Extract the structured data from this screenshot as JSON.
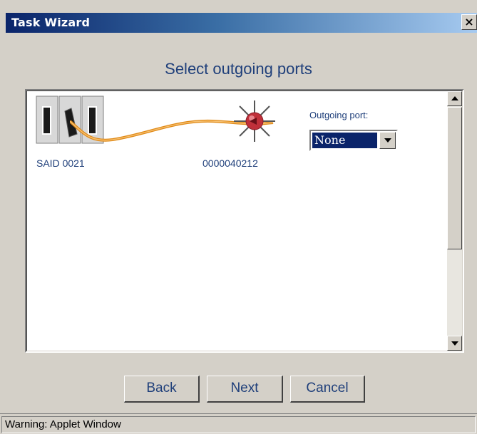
{
  "window": {
    "title": "Task Wizard",
    "close_label": "×"
  },
  "heading": "Select outgoing ports",
  "diagram": {
    "source_label": "SAID 0021",
    "target_label": "0000040212",
    "cable_color": "#f0a030",
    "port_dot_color": "#c0303a"
  },
  "outgoing_port": {
    "label": "Outgoing port:",
    "selected": "None"
  },
  "buttons": {
    "back": "Back",
    "next": "Next",
    "cancel": "Cancel"
  },
  "status": "Warning: Applet Window",
  "colors": {
    "title_start": "#0a246a",
    "title_end": "#a6caf0",
    "text_blue": "#1f3f7a"
  }
}
